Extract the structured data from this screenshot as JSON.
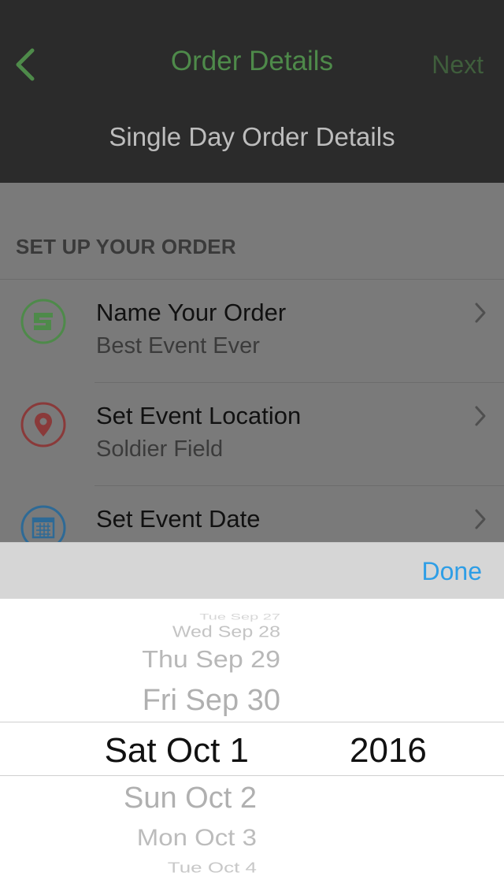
{
  "navbar": {
    "title": "Order Details",
    "next_label": "Next",
    "subtitle": "Single Day Order Details",
    "back_icon": "chevron-left-icon"
  },
  "section": {
    "header": "SET UP YOUR ORDER"
  },
  "rows": [
    {
      "title": "Name Your Order",
      "subtitle": "Best Event Ever",
      "icon": "order-name-icon"
    },
    {
      "title": "Set Event Location",
      "subtitle": "Soldier Field",
      "icon": "map-pin-icon"
    },
    {
      "title": "Set Event Date",
      "subtitle": "",
      "icon": "calendar-icon"
    }
  ],
  "toolbar": {
    "done_label": "Done"
  },
  "picker": {
    "dates_above": [
      "Tue Sep 27",
      "Wed Sep 28",
      "Thu Sep 29",
      "Fri Sep 30"
    ],
    "selected_date": "Sat Oct 1",
    "dates_below": [
      "Sun Oct 2",
      "Mon Oct 3",
      "Tue Oct 4"
    ],
    "selected_year": "2016"
  },
  "colors": {
    "accent_green": "#4e8a4a",
    "accent_red": "#8a3a3a",
    "accent_blue": "#2e6a96",
    "done_blue": "#2e9ee6"
  }
}
